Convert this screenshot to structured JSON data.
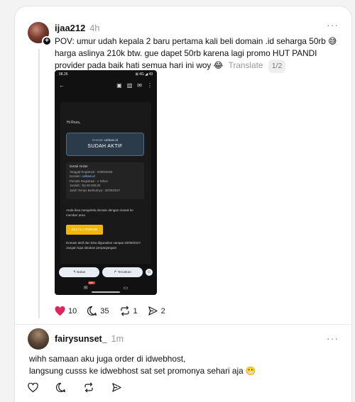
{
  "post1": {
    "username": "ijaa212",
    "time": "4h",
    "more": "···",
    "text": "POV: umur udah kepala 2 baru pertama kali beli domain .id seharga 50rb 😅 harga aslinya 210k btw. gue dapet 50rb karena lagi promo HUT PANDI provider pada baik hati semua hari ini woy 😂",
    "translate": "Translate",
    "pager": "1/2",
    "likes": "10",
    "replies": "35",
    "reposts": "1",
    "shares": "2"
  },
  "screenshot": {
    "status_time": "08.26",
    "status_right": "⊠ 4G ◢ 49",
    "greeting": "Hi Roza,",
    "domain_label": "Domain",
    "domain_name": "cahtani.id",
    "status": "SUDAH AKTIF",
    "detail_title": "Detail Order",
    "reg_date": "Tanggal Registrasi : 20/09/2026",
    "domain_line_label": "Domain:",
    "domain_line_value": "cahtani.id",
    "period": "Periode Registrasi : 1 Tahun",
    "amount": "Jumlah : Rp 50.000,00",
    "due": "Jatuh Tempo Berikutnya : 20/09/2027",
    "manage_text": "Anda bisa mengelola domain dengan masuk ke member area",
    "button": "KELOLA DOMAIN",
    "active_text": "Domain aktif dan bisa digunakan sampai 20/09/2027. Jangan lupa lakukan perpanjangan!",
    "reply": "Balas",
    "forward": "Teruskan",
    "badge": "99+"
  },
  "post2": {
    "username": "fairysunset_",
    "time": "1m",
    "more": "···",
    "line1": "wihh samaan aku juga order di idwebhost,",
    "line2": "langsung cusss ke idwebhost sat set promonya sehari aja 😬"
  },
  "colors": {
    "heart": "#e0245e",
    "accent": "#f2b705"
  }
}
